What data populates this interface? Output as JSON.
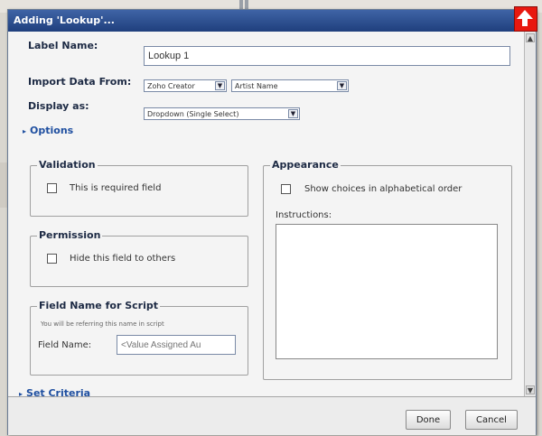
{
  "dialog": {
    "title": "Adding 'Lookup'..."
  },
  "form": {
    "label_name": {
      "label": "Label Name:",
      "value": "Lookup 1"
    },
    "import_data": {
      "label": "Import Data From:",
      "source": "Zoho Creator",
      "field": "Artist Name"
    },
    "display_as": {
      "label": "Display as:",
      "value": "Dropdown (Single Select)"
    },
    "options_link": "Options"
  },
  "validation": {
    "legend": "Validation",
    "checkbox_label": "This is required field"
  },
  "permission": {
    "legend": "Permission",
    "checkbox_label": "Hide this field to others"
  },
  "field_name_script": {
    "legend": "Field Name for Script",
    "note": "You will be referring this name in script",
    "label": "Field Name:",
    "placeholder": "<Value Assigned Au"
  },
  "appearance": {
    "legend": "Appearance",
    "checkbox_label": "Show choices in alphabetical order",
    "instructions_label": "Instructions:"
  },
  "set_criteria_link": "Set Criteria",
  "buttons": {
    "done": "Done",
    "cancel": "Cancel"
  },
  "colors": {
    "titlebar": "#2a4d8f",
    "link": "#1f4fa0",
    "up_button": "#e8180f"
  }
}
